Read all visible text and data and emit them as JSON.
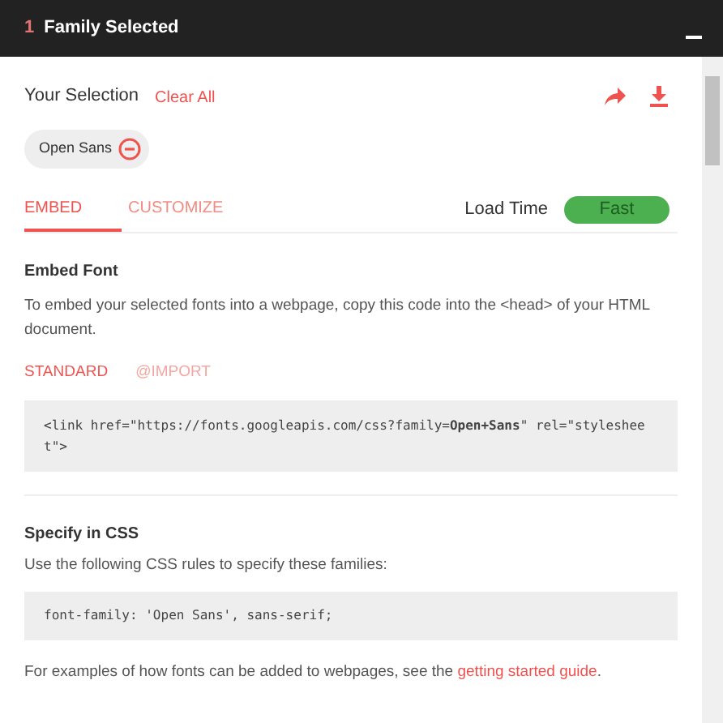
{
  "header": {
    "count": "1",
    "title": "Family Selected"
  },
  "selection": {
    "title": "Your Selection",
    "clear": "Clear All"
  },
  "families": [
    {
      "name": "Open Sans"
    }
  ],
  "tabs": [
    {
      "label": "EMBED",
      "selected": true
    },
    {
      "label": "CUSTOMIZE",
      "selected": false
    }
  ],
  "load_time": {
    "label": "Load Time",
    "value": "Fast"
  },
  "embed": {
    "title": "Embed Font",
    "text": "To embed your selected fonts into a webpage, copy this code into the <head> of your HTML document.",
    "modes": [
      {
        "label": "STANDARD",
        "selected": true
      },
      {
        "label": "@IMPORT",
        "selected": false
      }
    ],
    "code": "<link href=\"https://fonts.googleapis.com/css?family=**Open+Sans**\" rel=\"stylesheet\">"
  },
  "css": {
    "title": "Specify in CSS",
    "text": "Use the following CSS rules to specify these families:",
    "code": "font-family: 'Open Sans', sans-serif;"
  },
  "footer": {
    "text": "For examples of how fonts can be added to webpages, see the ",
    "link": "getting started guide",
    "after": "."
  }
}
